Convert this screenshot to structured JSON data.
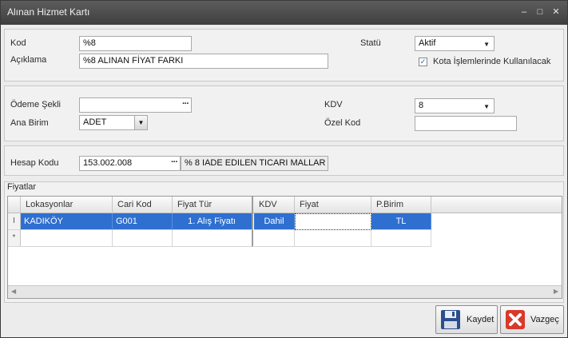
{
  "window": {
    "title": "Alınan Hizmet Kartı",
    "min_glyph": "–",
    "max_glyph": "□",
    "close_glyph": "✕"
  },
  "general": {
    "kod_label": "Kod",
    "kod_value": "%8",
    "aciklama_label": "Açıklama",
    "aciklama_value": "%8 ALINAN FİYAT FARKI",
    "statu_label": "Statü",
    "statu_value": "Aktif",
    "kota_label": "Kota İşlemlerinde Kullanılacak",
    "kota_checked": true
  },
  "payment": {
    "odeme_label": "Ödeme Şekli",
    "odeme_value": "",
    "ana_birim_label": "Ana Birim",
    "ana_birim_value": "ADET",
    "kdv_label": "KDV",
    "kdv_value": "8",
    "ozel_kod_label": "Özel Kod",
    "ozel_kod_value": ""
  },
  "account": {
    "hesap_label": "Hesap Kodu",
    "hesap_value": "153.002.008",
    "hesap_desc": "% 8 IADE EDILEN TICARI MALLAR"
  },
  "prices": {
    "group_label": "Fiyatlar",
    "columns": [
      "Lokasyonlar",
      "Cari Kod",
      "Fiyat Tür",
      "KDV",
      "Fiyat",
      "P.Birim"
    ],
    "rows": [
      {
        "indicator": "I",
        "lokasyon": "KADIKÖY",
        "cari_kod": "G001",
        "fiyat_tur": "1. Alış Fiyatı",
        "kdv": "Dahil",
        "fiyat": "",
        "pbirim": "TL"
      }
    ],
    "new_row_indicator": "*"
  },
  "buttons": {
    "save_label": "Kaydet",
    "cancel_label": "Vazgeç"
  },
  "colors": {
    "selection": "#2f6fd0",
    "titlebar": "#4a4a4a",
    "cancel_icon": "#d8392b",
    "save_icon": "#2c4f8c"
  }
}
